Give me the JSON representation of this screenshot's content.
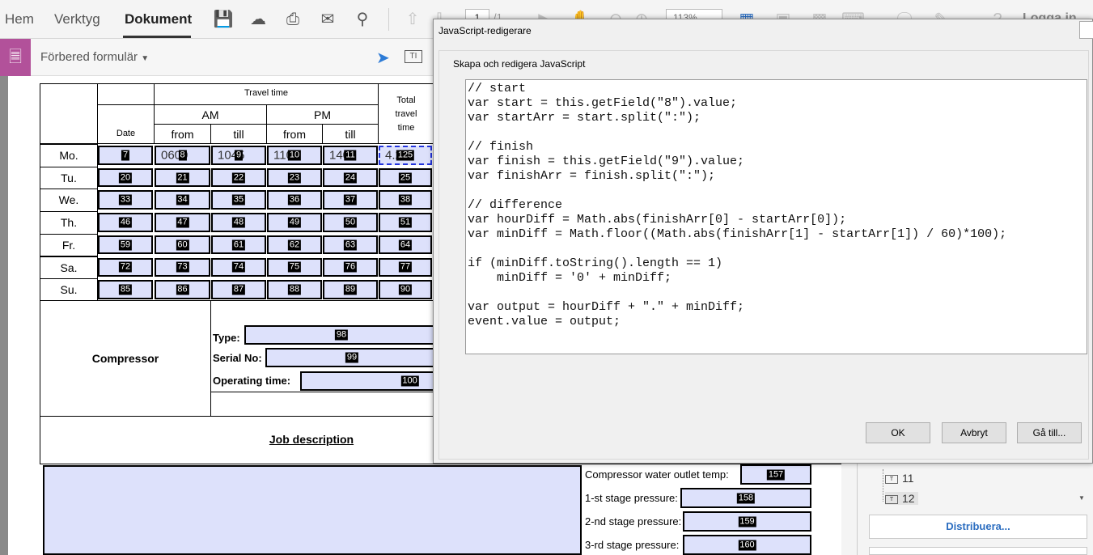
{
  "nav": {
    "tabs": [
      "Hem",
      "Verktyg",
      "Dokument"
    ],
    "active": "Dokument"
  },
  "toolbar": {
    "page_current": "1",
    "page_total": "/1",
    "zoom": "113%",
    "login": "Logga in"
  },
  "subbar": {
    "title": "Förbered formulär"
  },
  "form": {
    "header": {
      "travel_time": "Travel time",
      "am": "AM",
      "pm": "PM",
      "date": "Date",
      "from": "from",
      "till": "till",
      "total1": "Total",
      "total2": "travel",
      "total3": "time"
    },
    "rows": [
      {
        "day": "Mo.",
        "ids": [
          "7",
          "8",
          "9",
          "10",
          "11",
          "125"
        ],
        "vals": [
          "",
          "0600",
          "1045",
          "1100",
          "1400",
          "4.25"
        ]
      },
      {
        "day": "Tu.",
        "ids": [
          "20",
          "21",
          "22",
          "23",
          "24",
          "25"
        ],
        "vals": [
          "",
          "",
          "",
          "",
          "",
          ""
        ]
      },
      {
        "day": "We.",
        "ids": [
          "33",
          "34",
          "35",
          "36",
          "37",
          "38"
        ],
        "vals": [
          "",
          "",
          "",
          "",
          "",
          ""
        ]
      },
      {
        "day": "Th.",
        "ids": [
          "46",
          "47",
          "48",
          "49",
          "50",
          "51"
        ],
        "vals": [
          "",
          "",
          "",
          "",
          "",
          ""
        ]
      },
      {
        "day": "Fr.",
        "ids": [
          "59",
          "60",
          "61",
          "62",
          "63",
          "64"
        ],
        "vals": [
          "",
          "",
          "",
          "",
          "",
          ""
        ]
      },
      {
        "day": "Sa.",
        "ids": [
          "72",
          "73",
          "74",
          "75",
          "76",
          "77"
        ],
        "vals": [
          "",
          "",
          "",
          "",
          "",
          ""
        ]
      },
      {
        "day": "Su.",
        "ids": [
          "85",
          "86",
          "87",
          "88",
          "89",
          "90"
        ],
        "vals": [
          "",
          "",
          "",
          "",
          "",
          ""
        ]
      }
    ],
    "compressor": {
      "label": "Compressor",
      "type_label": "Type:",
      "type_id": "98",
      "serial_label": "Serial No:",
      "serial_id": "99",
      "optime_label": "Operating time:",
      "optime_id": "100"
    },
    "job_description": "Job description",
    "measurements": [
      {
        "label": "Compressor water outlet temp:",
        "id": "157"
      },
      {
        "label": "1-st stage pressure:",
        "id": "158"
      },
      {
        "label": "2-nd stage pressure:",
        "id": "159"
      },
      {
        "label": "3-rd stage pressure:",
        "id": "160"
      }
    ]
  },
  "sidepanel": {
    "items": [
      "11",
      "12"
    ],
    "distribute": "Distribuera..."
  },
  "dialog": {
    "title": "JavaScript-redigerare",
    "group": "Skapa och redigera JavaScript",
    "code": "// start\nvar start = this.getField(\"8\").value;\nvar startArr = start.split(\":\");\n\n// finish\nvar finish = this.getField(\"9\").value;\nvar finishArr = finish.split(\":\");\n\n// difference\nvar hourDiff = Math.abs(finishArr[0] - startArr[0]);\nvar minDiff = Math.floor((Math.abs(finishArr[1] - startArr[1]) / 60)*100);\n\nif (minDiff.toString().length == 1)\n    minDiff = '0' + minDiff;\n\nvar output = hourDiff + \".\" + minDiff;\nevent.value = output;",
    "ok": "OK",
    "cancel": "Avbryt",
    "goto": "Gå till..."
  }
}
